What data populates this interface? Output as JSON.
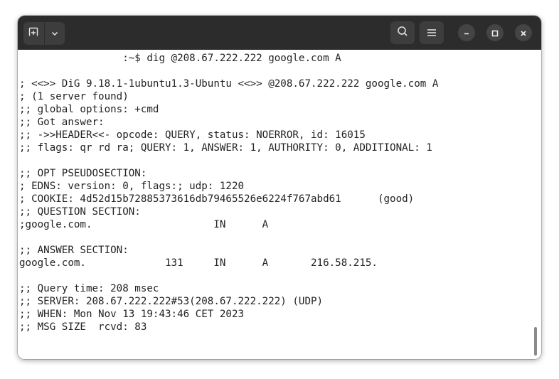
{
  "window": {
    "controls": {
      "new_tab_icon": "new-tab-icon",
      "dropdown_icon": "chevron-down-icon",
      "search_icon": "search-icon",
      "menu_icon": "hamburger-menu-icon",
      "minimize_icon": "minimize-icon",
      "maximize_icon": "maximize-icon",
      "close_icon": "close-icon"
    },
    "titlebar_color": "#2c2c2c"
  },
  "terminal": {
    "lines": [
      "                 :~$ dig @208.67.222.222 google.com A",
      "",
      "; <<>> DiG 9.18.1-1ubuntu1.3-Ubuntu <<>> @208.67.222.222 google.com A",
      "; (1 server found)",
      ";; global options: +cmd",
      ";; Got answer:",
      ";; ->>HEADER<<- opcode: QUERY, status: NOERROR, id: 16015",
      ";; flags: qr rd ra; QUERY: 1, ANSWER: 1, AUTHORITY: 0, ADDITIONAL: 1",
      "",
      ";; OPT PSEUDOSECTION:",
      "; EDNS: version: 0, flags:; udp: 1220",
      "; COOKIE: 4d52d15b72885373616db79465526e6224f767abd61      (good)",
      ";; QUESTION SECTION:",
      ";google.com.                    IN      A",
      "",
      ";; ANSWER SECTION:",
      "google.com.             131     IN      A       216.58.215.",
      "",
      ";; Query time: 208 msec",
      ";; SERVER: 208.67.222.222#53(208.67.222.222) (UDP)",
      ";; WHEN: Mon Nov 13 19:43:46 CET 2023",
      ";; MSG SIZE  rcvd: 83"
    ],
    "text_color": "#232323",
    "background_color": "#ffffff"
  }
}
